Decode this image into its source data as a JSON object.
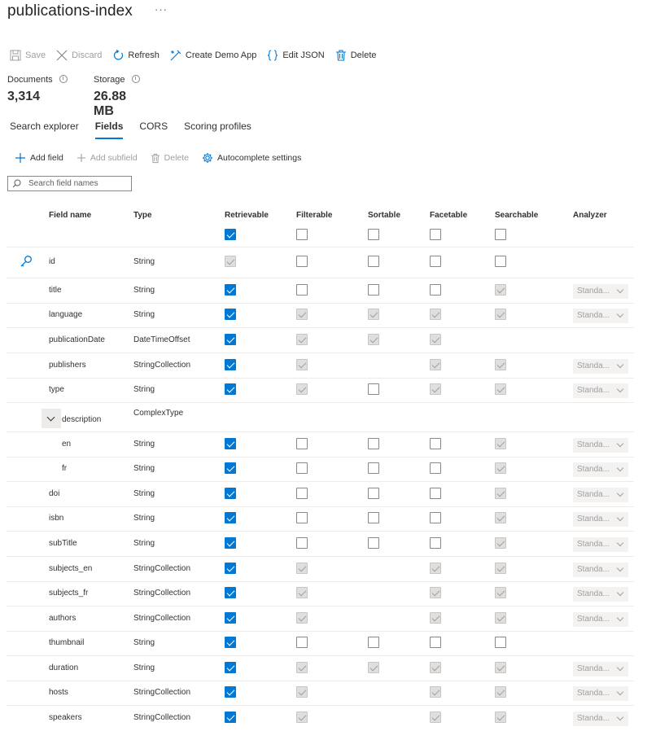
{
  "header": {
    "title": "publications-index",
    "more": "···"
  },
  "toolbar": {
    "save": "Save",
    "discard": "Discard",
    "refresh": "Refresh",
    "create_demo_app": "Create Demo App",
    "edit_json": "Edit JSON",
    "delete": "Delete"
  },
  "stats": {
    "documents_label": "Documents",
    "documents_value": "3,314",
    "storage_label": "Storage",
    "storage_value": "26.88 MB",
    "info_glyph": "i"
  },
  "tabs": [
    {
      "label": "Search explorer",
      "active": false
    },
    {
      "label": "Fields",
      "active": true
    },
    {
      "label": "CORS",
      "active": false
    },
    {
      "label": "Scoring profiles",
      "active": false
    }
  ],
  "fields_toolbar": {
    "add_field": "Add field",
    "add_subfield": "Add subfield",
    "delete": "Delete",
    "autocomplete": "Autocomplete settings"
  },
  "search": {
    "placeholder": "Search field names"
  },
  "columns": {
    "field_name": "Field name",
    "type": "Type",
    "retrievable": "Retrievable",
    "filterable": "Filterable",
    "sortable": "Sortable",
    "facetable": "Facetable",
    "searchable": "Searchable",
    "analyzer": "Analyzer"
  },
  "select_all": {
    "retrievable": "on",
    "filterable": "off",
    "sortable": "off",
    "facetable": "off",
    "searchable": "off"
  },
  "accent_color": "#0078d4",
  "rows": [
    {
      "name": "id",
      "type": "String",
      "key": true,
      "r": "dis",
      "f": "off",
      "s": "off",
      "fa": "off",
      "se": "off",
      "analyzer": ""
    },
    {
      "name": "title",
      "type": "String",
      "r": "on",
      "f": "off",
      "s": "off",
      "fa": "off",
      "se": "dis",
      "analyzer": "Standa..."
    },
    {
      "name": "language",
      "type": "String",
      "r": "on",
      "f": "dis",
      "s": "dis",
      "fa": "dis",
      "se": "dis",
      "analyzer": "Standa..."
    },
    {
      "name": "publicationDate",
      "type": "DateTimeOffset",
      "r": "on",
      "f": "dis",
      "s": "dis",
      "fa": "dis",
      "se": "",
      "analyzer": ""
    },
    {
      "name": "publishers",
      "type": "StringCollection",
      "r": "on",
      "f": "dis",
      "s": "",
      "fa": "dis",
      "se": "dis",
      "analyzer": "Standa..."
    },
    {
      "name": "type",
      "type": "String",
      "r": "on",
      "f": "dis",
      "s": "off",
      "fa": "dis",
      "se": "dis",
      "analyzer": "Standa..."
    },
    {
      "name": "description",
      "type": "ComplexType",
      "complex": true,
      "r": "",
      "f": "",
      "s": "",
      "fa": "",
      "se": "",
      "analyzer": ""
    },
    {
      "name": "en",
      "type": "String",
      "indent": true,
      "r": "on",
      "f": "off",
      "s": "off",
      "fa": "off",
      "se": "dis",
      "analyzer": "Standa..."
    },
    {
      "name": "fr",
      "type": "String",
      "indent": true,
      "r": "on",
      "f": "off",
      "s": "off",
      "fa": "off",
      "se": "dis",
      "analyzer": "Standa..."
    },
    {
      "name": "doi",
      "type": "String",
      "r": "on",
      "f": "off",
      "s": "off",
      "fa": "off",
      "se": "dis",
      "analyzer": "Standa..."
    },
    {
      "name": "isbn",
      "type": "String",
      "r": "on",
      "f": "off",
      "s": "off",
      "fa": "off",
      "se": "dis",
      "analyzer": "Standa..."
    },
    {
      "name": "subTitle",
      "type": "String",
      "r": "on",
      "f": "off",
      "s": "off",
      "fa": "off",
      "se": "dis",
      "analyzer": "Standa..."
    },
    {
      "name": "subjects_en",
      "type": "StringCollection",
      "r": "on",
      "f": "dis",
      "s": "",
      "fa": "dis",
      "se": "dis",
      "analyzer": "Standa..."
    },
    {
      "name": "subjects_fr",
      "type": "StringCollection",
      "r": "on",
      "f": "dis",
      "s": "",
      "fa": "dis",
      "se": "dis",
      "analyzer": "Standa..."
    },
    {
      "name": "authors",
      "type": "StringCollection",
      "r": "on",
      "f": "dis",
      "s": "",
      "fa": "dis",
      "se": "dis",
      "analyzer": "Standa..."
    },
    {
      "name": "thumbnail",
      "type": "String",
      "r": "on",
      "f": "off",
      "s": "off",
      "fa": "off",
      "se": "off",
      "analyzer": ""
    },
    {
      "name": "duration",
      "type": "String",
      "r": "on",
      "f": "dis",
      "s": "dis",
      "fa": "dis",
      "se": "dis",
      "analyzer": "Standa..."
    },
    {
      "name": "hosts",
      "type": "StringCollection",
      "r": "on",
      "f": "dis",
      "s": "",
      "fa": "dis",
      "se": "dis",
      "analyzer": "Standa..."
    },
    {
      "name": "speakers",
      "type": "StringCollection",
      "r": "on",
      "f": "dis",
      "s": "",
      "fa": "dis",
      "se": "dis",
      "analyzer": "Standa..."
    }
  ]
}
